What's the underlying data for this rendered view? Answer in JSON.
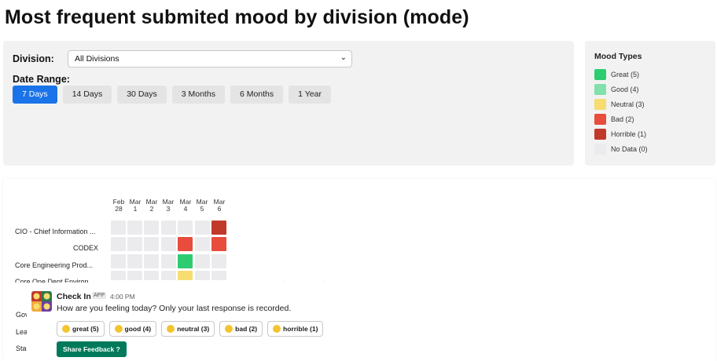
{
  "page": {
    "title": "Most frequent submited mood by division (mode)"
  },
  "filters": {
    "division_label": "Division:",
    "division_value": "All Divisions",
    "date_range_label": "Date Range:",
    "ranges": [
      "7 Days",
      "14 Days",
      "30 Days",
      "3 Months",
      "6 Months",
      "1 Year"
    ],
    "active_range": "7 Days"
  },
  "legend": {
    "title": "Mood Types",
    "items": [
      {
        "label": "Great (5)",
        "color": "#2ecc71"
      },
      {
        "label": "Good (4)",
        "color": "#82e0aa"
      },
      {
        "label": "Neutral (3)",
        "color": "#f7dc6f"
      },
      {
        "label": "Bad (2)",
        "color": "#e74c3c"
      },
      {
        "label": "Horrible (1)",
        "color": "#c0392b"
      },
      {
        "label": "No Data (0)",
        "color": "#ebebee"
      }
    ]
  },
  "heatmap": {
    "dates": [
      {
        "month": "Feb",
        "day": "28"
      },
      {
        "month": "Mar",
        "day": "1"
      },
      {
        "month": "Mar",
        "day": "2"
      },
      {
        "month": "Mar",
        "day": "3"
      },
      {
        "month": "Mar",
        "day": "4"
      },
      {
        "month": "Mar",
        "day": "5"
      },
      {
        "month": "Mar",
        "day": "6"
      }
    ],
    "rows": [
      {
        "division": "CIO - Chief Information ...",
        "moods": [
          0,
          0,
          0,
          0,
          0,
          0,
          1
        ]
      },
      {
        "division": "CODEX",
        "moods": [
          0,
          0,
          0,
          0,
          2,
          0,
          2
        ]
      },
      {
        "division": "Core Engineering Prod...",
        "moods": [
          0,
          0,
          0,
          0,
          5,
          0,
          0
        ]
      },
      {
        "division": "Core One Dept Environ...",
        "moods": [
          0,
          0,
          0,
          0,
          3,
          0,
          0
        ]
      }
    ],
    "partial_labels": [
      "Gov",
      "Lea",
      "Sta"
    ]
  },
  "message": {
    "sender": "Check In",
    "badge": "APP",
    "time": "4:00 PM",
    "text": "How are you feeling today? Only your last response is recorded.",
    "mood_buttons": [
      "great (5)",
      "good (4)",
      "neutral (3)",
      "bad (2)",
      "horrible (1)"
    ],
    "share_button": "Share Feedback ?"
  }
}
